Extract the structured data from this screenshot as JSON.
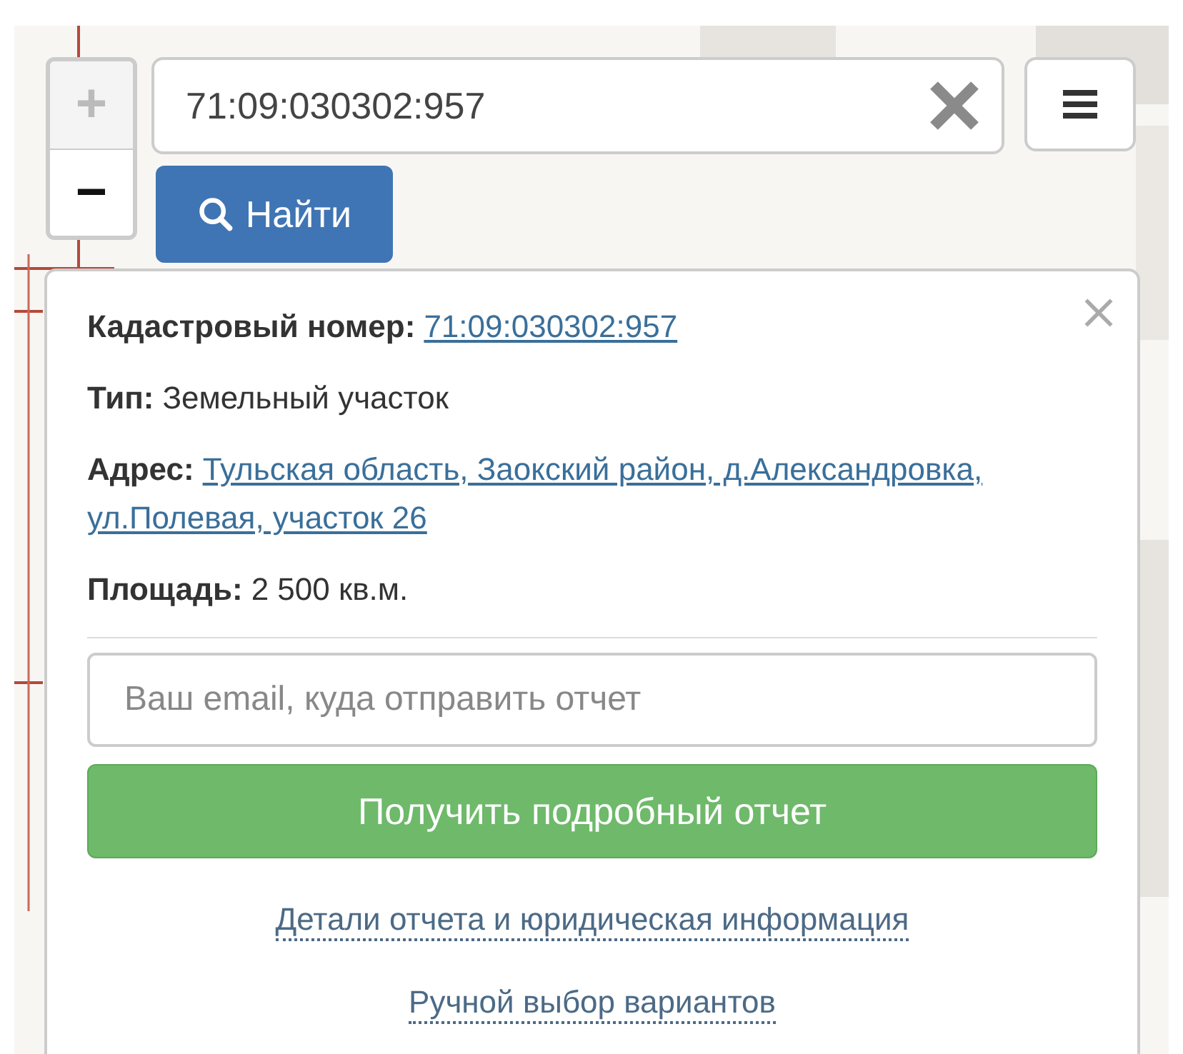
{
  "zoom": [
    {
      "label": "+",
      "disabled": true
    },
    {
      "label": "−",
      "disabled": false
    }
  ],
  "search": {
    "value": "71:09:030302:957",
    "button": "Найти"
  },
  "popup": {
    "fields": [
      {
        "label": "Кадастровый номер:",
        "lines": [
          "71:09:030302:957"
        ],
        "kind": "link"
      },
      {
        "label": "Тип:",
        "value": "Земельный участок",
        "kind": "text"
      },
      {
        "label": "Адрес:",
        "lines": [
          "Тульская область, Заокский район, д.Александровка,",
          "ул.Полевая, участок 26"
        ],
        "kind": "link"
      },
      {
        "label": "Площадь:",
        "value": "2 500 кв.м.",
        "kind": "text"
      }
    ],
    "email": {
      "placeholder": "Ваш email, куда отправить отчет"
    },
    "submit": "Получить подробный отчет",
    "links": [
      "Детали отчета и юридическая информация",
      "Ручной выбор вариантов"
    ]
  }
}
